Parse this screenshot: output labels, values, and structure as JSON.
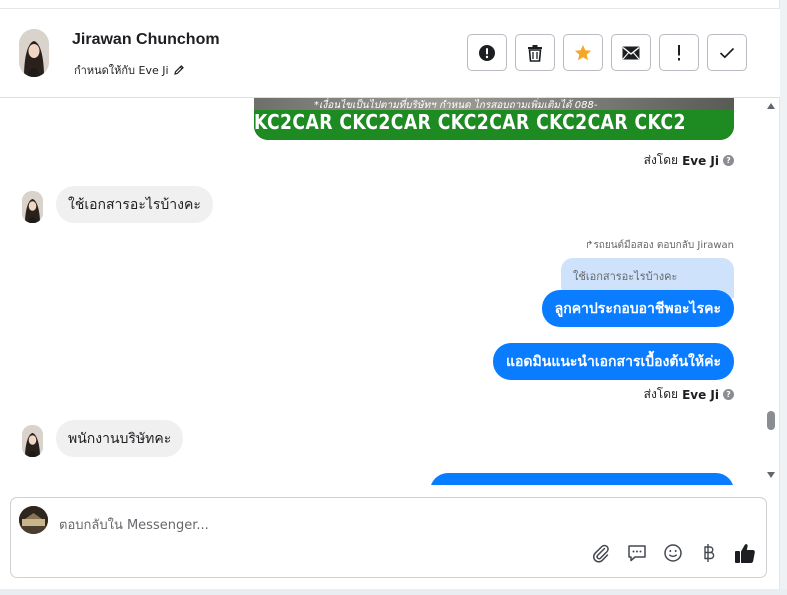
{
  "header": {
    "contact_name": "Jirawan Chunchom",
    "assigned_label": "กำหนดให้กับ Eve Ji"
  },
  "actions": [
    {
      "name": "alert-circle-icon"
    },
    {
      "name": "trash-icon"
    },
    {
      "name": "star-icon",
      "color": "#f5a623"
    },
    {
      "name": "envelope-icon"
    },
    {
      "name": "exclamation-icon"
    },
    {
      "name": "check-icon"
    }
  ],
  "banner": {
    "caption": "*เงื่อนไขเป็นไปตามที่บริษัทฯ กำหนด ไกรสอบถามเพิ่มเติมได้ 088-",
    "brand_text": "KC2CAR CKC2CAR CKC2CAR CKC2CAR CKC2"
  },
  "messages": {
    "sent_by_1": {
      "prefix": "ส่งโดย",
      "agent": "Eve Ji"
    },
    "incoming_1": "ใช้เอกสารอะไรบ้างคะ",
    "reply_note": "รถยนต์มือสอง ตอบกลับ Jirawan",
    "reply_quote": "ใช้เอกสารอะไรบ้างคะ",
    "outgoing_1": "ลูกคาประกอบอาชีพอะไรคะ",
    "outgoing_2": "แอดมินแนะนำเอกสารเบื้องต้นให้ค่ะ",
    "sent_by_2": {
      "prefix": "ส่งโดย",
      "agent": "Eve Ji"
    },
    "incoming_2": "พนักงานบริษัทคะ"
  },
  "composer": {
    "placeholder": "ตอบกลับใน Messenger..."
  },
  "colors": {
    "outgoing_bubble": "#0a7cff",
    "incoming_bubble": "#f0f0f0",
    "quote_bubble": "#cfe2fb",
    "banner_green": "#1e8a22"
  }
}
